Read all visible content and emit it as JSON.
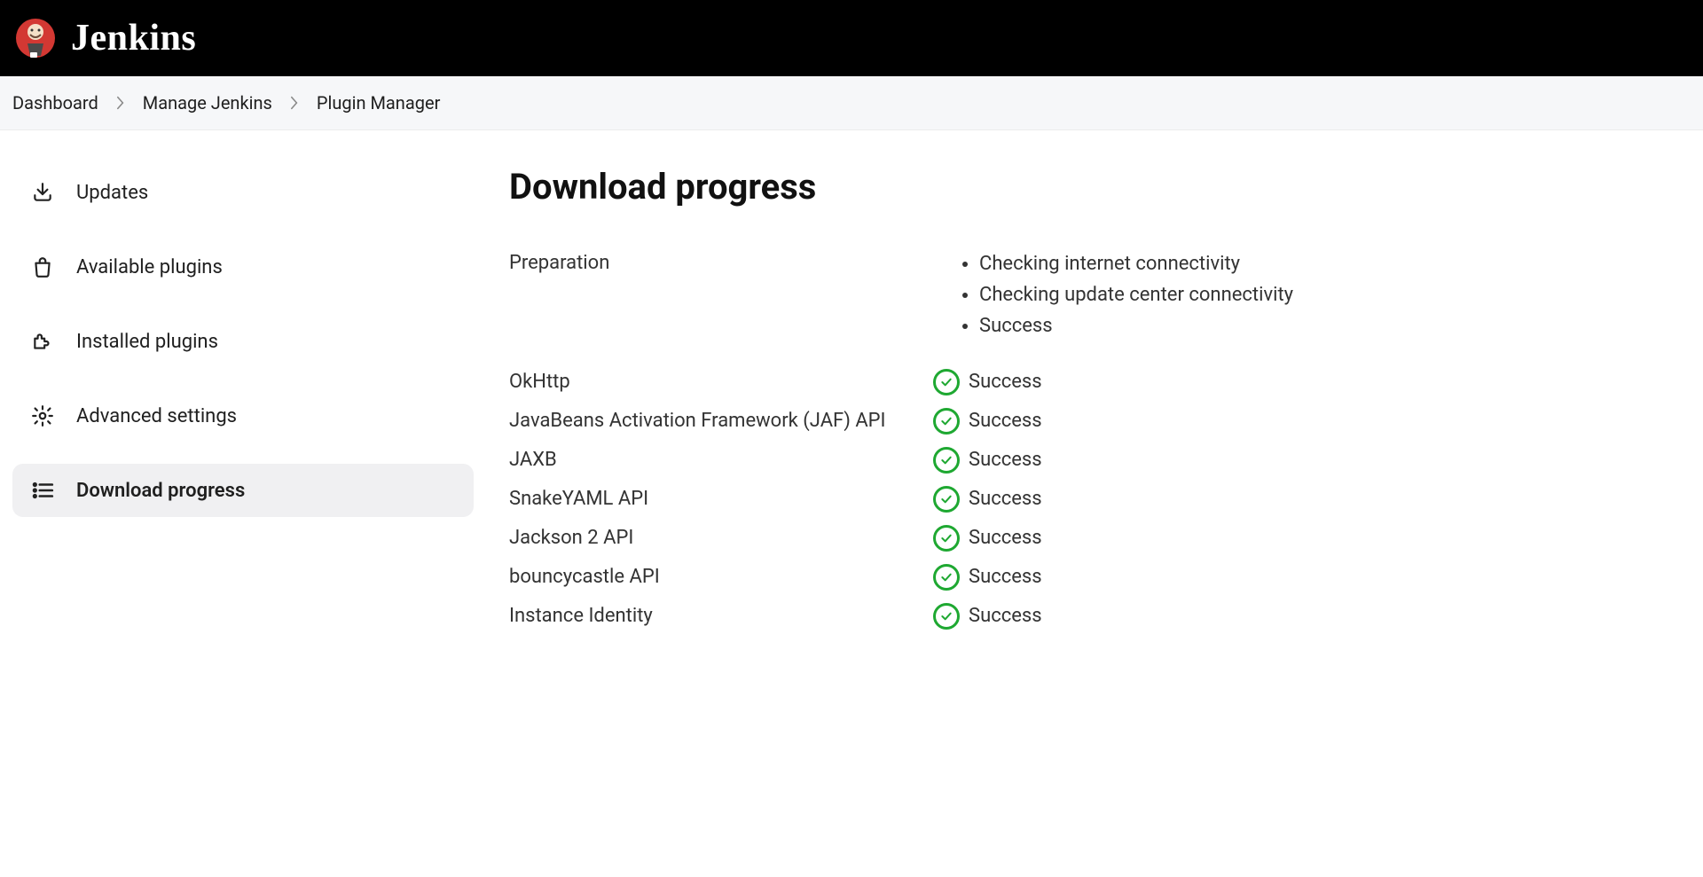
{
  "header": {
    "brand": "Jenkins"
  },
  "breadcrumb": {
    "items": [
      "Dashboard",
      "Manage Jenkins",
      "Plugin Manager"
    ]
  },
  "sidebar": {
    "items": [
      {
        "label": "Updates",
        "icon": "download-icon",
        "active": false
      },
      {
        "label": "Available plugins",
        "icon": "bag-icon",
        "active": false
      },
      {
        "label": "Installed plugins",
        "icon": "puzzle-icon",
        "active": false
      },
      {
        "label": "Advanced settings",
        "icon": "gear-icon",
        "active": false
      },
      {
        "label": "Download progress",
        "icon": "list-icon",
        "active": true
      }
    ]
  },
  "main": {
    "title": "Download progress",
    "preparation": {
      "label": "Preparation",
      "steps": [
        "Checking internet connectivity",
        "Checking update center connectivity",
        "Success"
      ]
    },
    "downloads": [
      {
        "name": "OkHttp",
        "status": "Success"
      },
      {
        "name": "JavaBeans Activation Framework (JAF) API",
        "status": "Success"
      },
      {
        "name": "JAXB",
        "status": "Success"
      },
      {
        "name": "SnakeYAML API",
        "status": "Success"
      },
      {
        "name": "Jackson 2 API",
        "status": "Success"
      },
      {
        "name": "bouncycastle API",
        "status": "Success"
      },
      {
        "name": "Instance Identity",
        "status": "Success"
      }
    ]
  },
  "colors": {
    "success": "#1ea831"
  }
}
